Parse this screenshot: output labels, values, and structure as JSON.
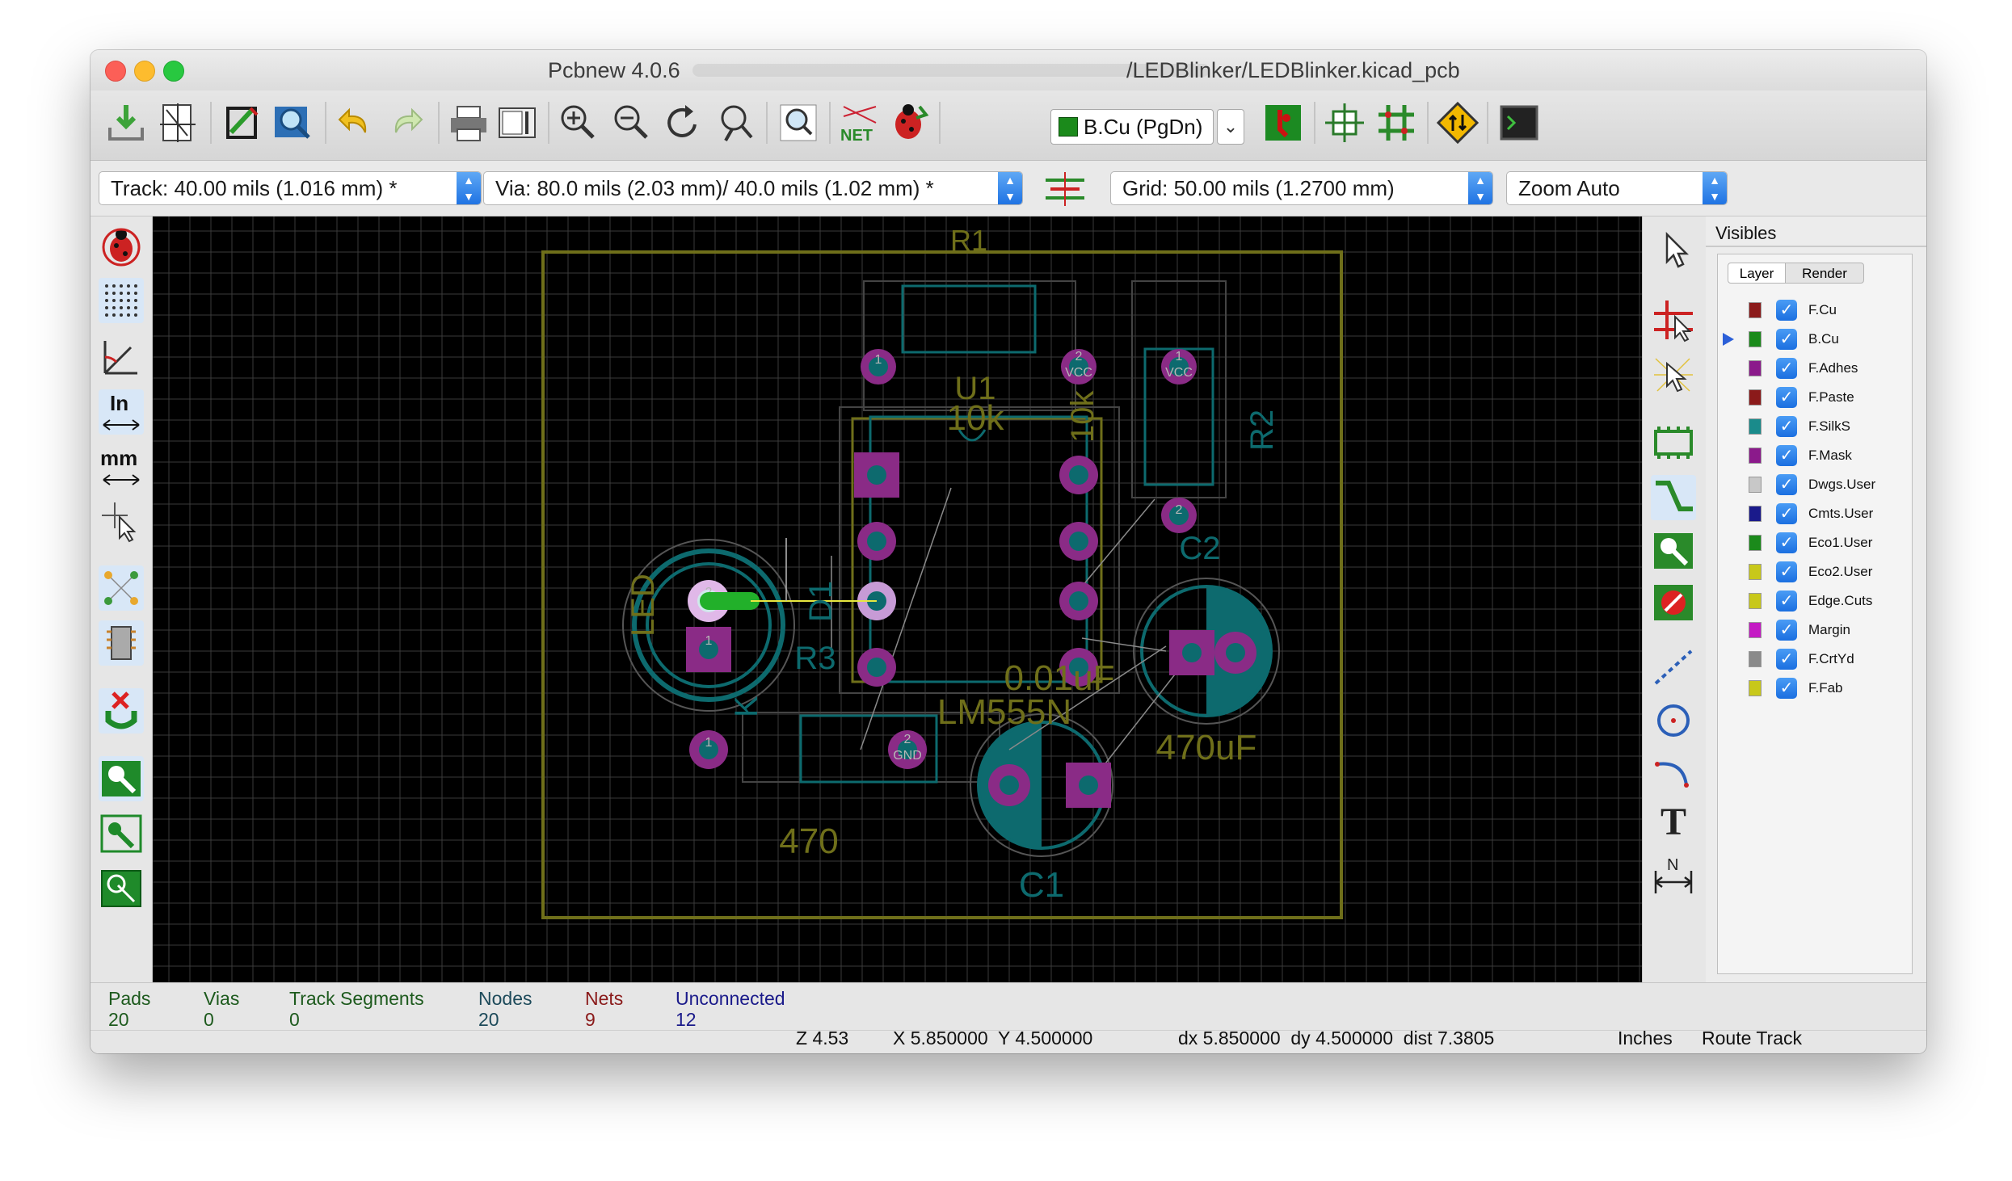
{
  "window": {
    "title_left": "Pcbnew 4.0.6",
    "title_right": "/LEDBlinker/LEDBlinker.kicad_pcb"
  },
  "colors": {
    "accent_blue": "#1f73e3",
    "board_outline": "#6f6f1a",
    "pad_purple": "#8a2b86",
    "copper_teal": "#0d6a6e",
    "track_green": "#22b02a"
  },
  "toolbar": {
    "layer_select": "B.Cu (PgDn)",
    "icons": [
      "open-icon",
      "page-settings-icon",
      "footprint-editor-icon",
      "library-browser-icon",
      "undo-icon",
      "redo-icon",
      "print-icon",
      "plot-icon",
      "zoom-in-icon",
      "zoom-out-icon",
      "redraw-icon",
      "zoom-fit-icon",
      "find-icon",
      "netlist-icon",
      "drc-icon",
      "layer-pair-icon",
      "autoplace-icon",
      "autoroute-icon",
      "microwave-icon",
      "scripting-icon"
    ]
  },
  "toolbar2": {
    "track": "Track: 40.00 mils (1.016 mm) *",
    "via": "Via: 80.0 mils (2.03 mm)/ 40.0 mils (1.02 mm) *",
    "grid": "Grid: 50.00 mils (1.2700 mm)",
    "zoom": "Zoom Auto"
  },
  "left_toolbar": {
    "icons": [
      "drc-off-icon",
      "grid-icon",
      "polar-coords-icon",
      "units-inches-icon",
      "units-mm-icon",
      "cursor-shape-icon",
      "ratsnest-icon",
      "module-ratsnest-icon",
      "auto-delete-track-icon",
      "zone-fill-icon",
      "zone-outline-icon",
      "zone-sketch-icon"
    ],
    "inch_label": "In",
    "mm_label": "mm"
  },
  "right_toolbar": {
    "icons": [
      "select-arrow-icon",
      "highlight-net-icon",
      "local-ratsnest-icon",
      "add-footprint-icon",
      "route-track-icon",
      "add-zone-icon",
      "keepout-icon",
      "add-line-icon",
      "add-circle-icon",
      "add-arc-icon",
      "add-text-icon",
      "add-dimension-icon"
    ],
    "text_tool_label": "T",
    "dimension_label": "N"
  },
  "pcb": {
    "labels": {
      "r1": "R1",
      "u1": "U1",
      "r2": "R2",
      "c2": "C2",
      "led": "LED",
      "d1": "D1",
      "r3": "R3",
      "lm555": "LM555N",
      "cap_001": "0.01uF",
      "cap_470": "470uF",
      "res_470": "470",
      "c1": "C1",
      "res_10k": "10k",
      "res_10k_b": "10k",
      "k": "K"
    },
    "pad_labels": {
      "one": "1",
      "two": "2",
      "vcc": "VCC",
      "gnd": "GND"
    }
  },
  "visibles": {
    "title": "Visibles",
    "tabs": [
      "Layer",
      "Render"
    ],
    "layers": [
      {
        "name": "F.Cu",
        "color": "#8b1a1a",
        "active": false
      },
      {
        "name": "B.Cu",
        "color": "#1b8a1b",
        "active": true
      },
      {
        "name": "F.Adhes",
        "color": "#8b1a8b",
        "active": false
      },
      {
        "name": "F.Paste",
        "color": "#8b1a1a",
        "active": false
      },
      {
        "name": "F.SilkS",
        "color": "#1a8b8b",
        "active": false
      },
      {
        "name": "F.Mask",
        "color": "#8b1a8b",
        "active": false
      },
      {
        "name": "Dwgs.User",
        "color": "#c8c8c8",
        "active": false
      },
      {
        "name": "Cmts.User",
        "color": "#1a1a8b",
        "active": false
      },
      {
        "name": "Eco1.User",
        "color": "#1b8a1b",
        "active": false
      },
      {
        "name": "Eco2.User",
        "color": "#c8c81a",
        "active": false
      },
      {
        "name": "Edge.Cuts",
        "color": "#c8c81a",
        "active": false
      },
      {
        "name": "Margin",
        "color": "#c41ac4",
        "active": false
      },
      {
        "name": "F.CrtYd",
        "color": "#8a8a8a",
        "active": false
      },
      {
        "name": "F.Fab",
        "color": "#c8c81a",
        "active": false
      }
    ]
  },
  "status": {
    "pads_label": "Pads",
    "pads_value": "20",
    "vias_label": "Vias",
    "vias_value": "0",
    "segments_label": "Track Segments",
    "segments_value": "0",
    "nodes_label": "Nodes",
    "nodes_value": "20",
    "nets_label": "Nets",
    "nets_value": "9",
    "unconnected_label": "Unconnected",
    "unconnected_value": "12",
    "zoom": "Z 4.53",
    "xy": "X 5.850000  Y 4.500000",
    "dxdy": "dx 5.850000  dy 4.500000  dist 7.3805",
    "units": "Inches",
    "mode": "Route Track"
  }
}
